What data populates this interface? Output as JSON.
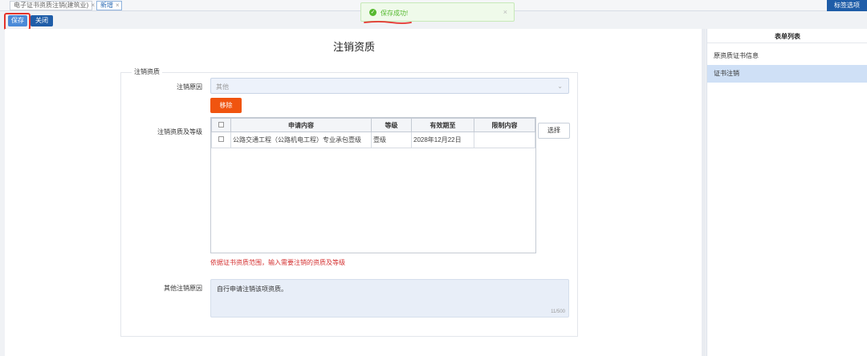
{
  "tabs": [
    {
      "label": "电子证书资质注销(建筑业)"
    },
    {
      "label": "新增"
    }
  ],
  "tab_close_glyph": "×",
  "tag_options_label": "标签选项",
  "toast": {
    "message": "保存成功!",
    "icon": "check-circle-icon",
    "close": "×"
  },
  "toolbar": {
    "save_label": "保存",
    "close_label": "关闭"
  },
  "page_title": "注销资质",
  "form": {
    "legend": "注销资质",
    "reason_label": "注销原因",
    "reason_value": "其他",
    "quali_label": "注销资质及等级",
    "remove_label": "移除",
    "select_label": "选择",
    "columns": [
      "申请内容",
      "等级",
      "有效期至",
      "限制内容"
    ],
    "rows": [
      {
        "content": "公路交通工程（公路机电工程）专业承包壹级",
        "grade": "壹级",
        "expiry": "2028年12月22日",
        "limit": ""
      }
    ],
    "hint": "依据证书资质范围，输入需要注销的资质及等级",
    "other_label": "其他注销原因",
    "other_value": "自行申请注销该项资质。",
    "char_count": "11/500"
  },
  "sidebar": {
    "title": "表单列表",
    "items": [
      {
        "label": "原资质证书信息"
      },
      {
        "label": "证书注销"
      }
    ]
  },
  "colors": {
    "accent": "#1f5da8",
    "remove": "#f0540f",
    "success": "#55b92f",
    "highlight": "#e4332b"
  }
}
